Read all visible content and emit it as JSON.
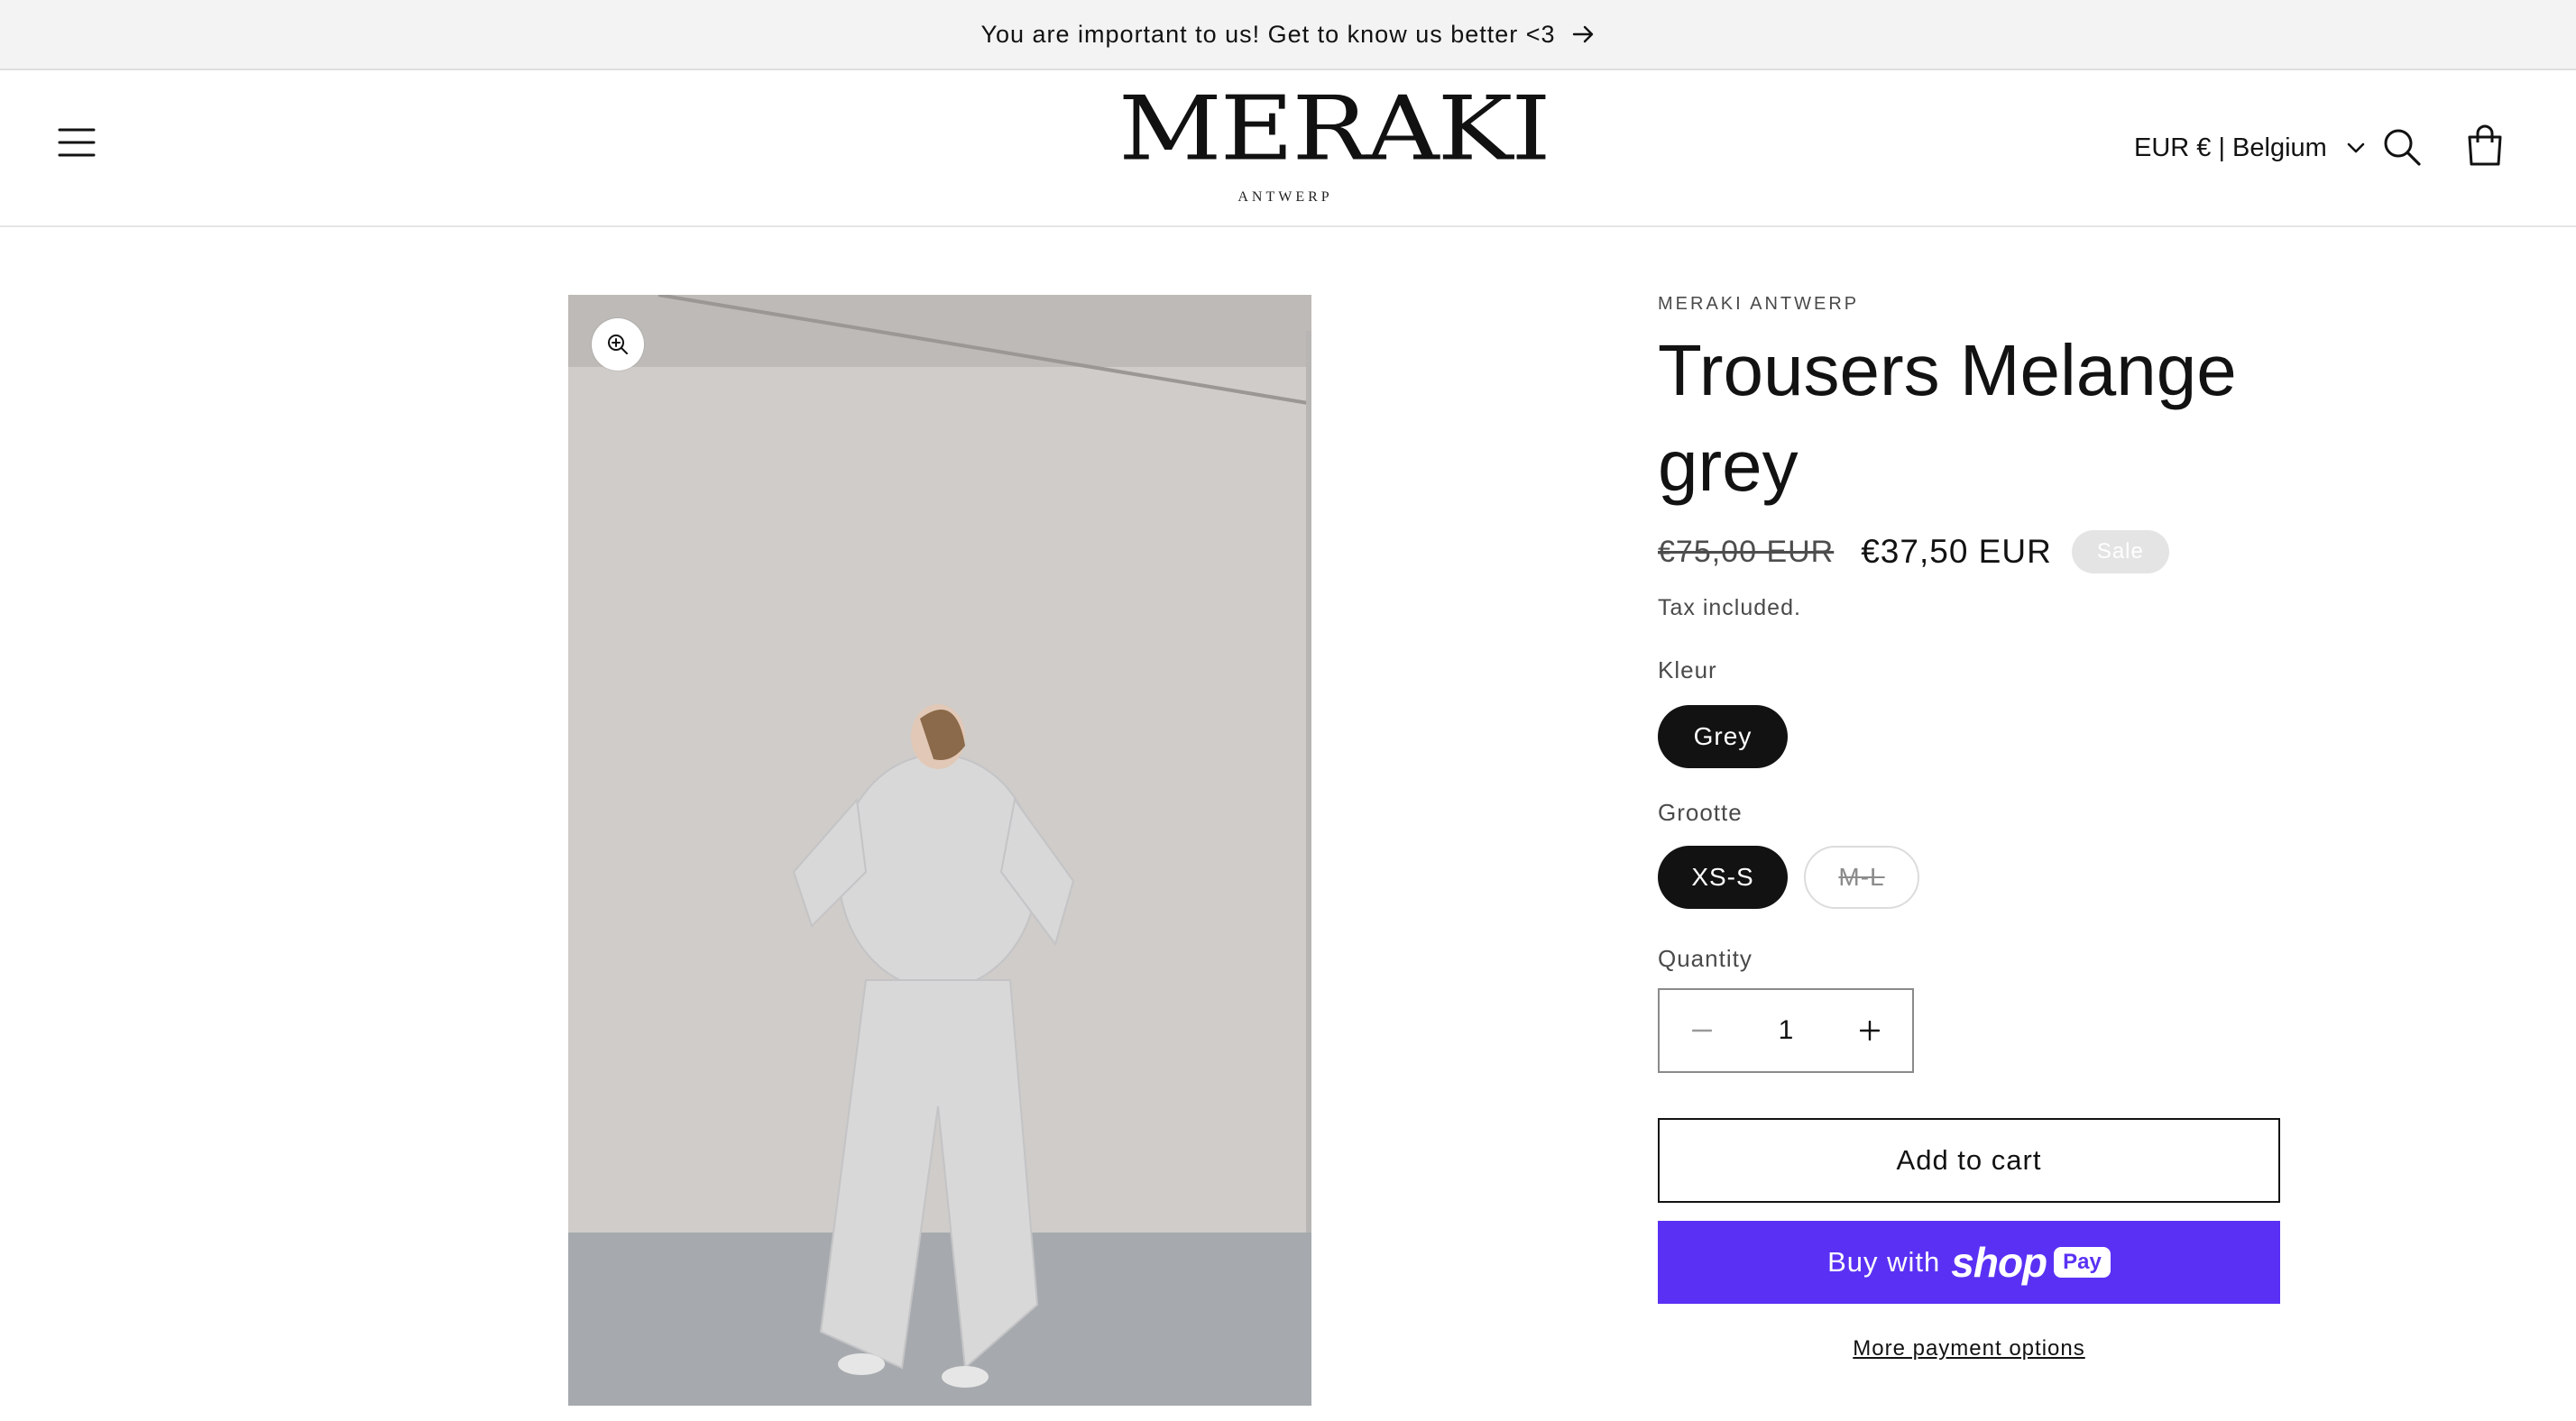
{
  "announcement": {
    "text": "You are important to us! Get to know us better <3"
  },
  "header": {
    "logo_main": "MERAKI",
    "logo_sub": "ANTWERP",
    "country_selector": "EUR € | Belgium"
  },
  "product": {
    "vendor": "MERAKI ANTWERP",
    "title": "Trousers Melange grey",
    "price_regular": "€75,00 EUR",
    "price_sale": "€37,50 EUR",
    "badge": "Sale",
    "tax_note": "Tax included.",
    "options": {
      "color_label": "Kleur",
      "color_values": [
        "Grey"
      ],
      "color_selected": "Grey",
      "size_label": "Grootte",
      "size_values": [
        "XS-S",
        "M-L"
      ],
      "size_selected": "XS-S",
      "size_unavailable": [
        "M-L"
      ]
    },
    "quantity_label": "Quantity",
    "quantity": "1",
    "add_to_cart": "Add to cart",
    "buy_with_prefix": "Buy with",
    "buy_with_brand": "shop",
    "buy_with_pay": "Pay",
    "more_payment": "More payment options"
  },
  "colors": {
    "accent_shop_pay": "#5a31f4",
    "selected_pill": "#121212",
    "announcement_bg": "#f3f3f3"
  },
  "icons": [
    "menu-icon",
    "search-icon",
    "cart-icon",
    "chevron-down-icon",
    "arrow-right-icon",
    "zoom-in-icon",
    "minus-icon",
    "plus-icon"
  ]
}
